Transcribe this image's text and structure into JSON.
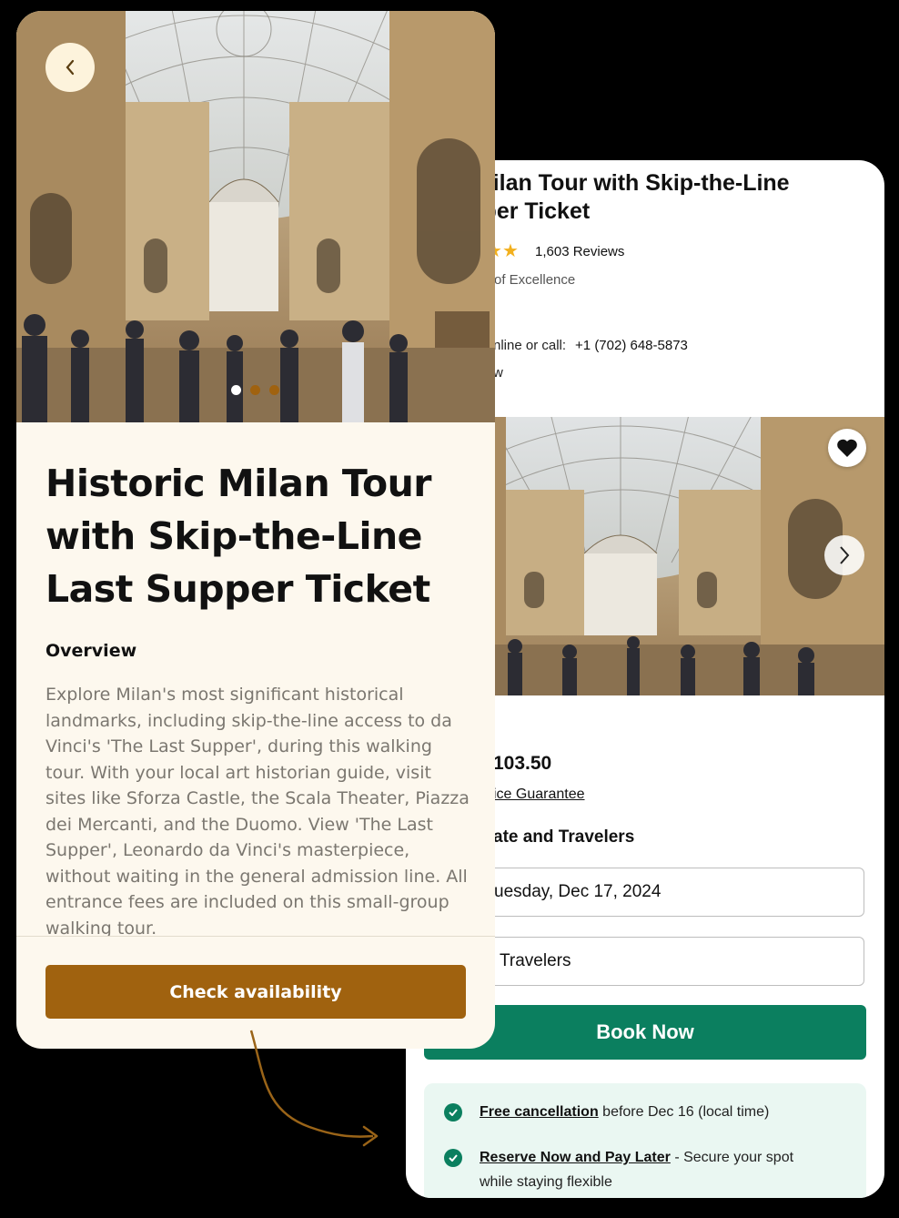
{
  "left": {
    "back_icon": "chevron-left-icon",
    "title": "Historic Milan Tour with Skip-the-Line Last Supper Ticket",
    "overview_heading": "Overview",
    "description": "Explore Milan's most significant historical landmarks, including skip-the-line access to da Vinci's 'The Last Supper', during this walking tour. With your local art historian guide, visit sites like Sforza Castle, the Scala Theater, Piazza dei Mercanti, and the Duomo. View 'The Last Supper', Leonardo da Vinci's masterpiece, without waiting in the general admission line. All entrance fees are included on this small-group walking tour.",
    "carousel_dots": 3,
    "carousel_active_index": 0,
    "check_button": "Check availability",
    "colors": {
      "background": "#fdf8ee",
      "accent": "#a0620f",
      "dot_active": "#ffffff",
      "dot_inactive": "#a0620f"
    }
  },
  "right": {
    "title": "c Milan Tour with Skip-the-Line\nupper Ticket",
    "reviews": "1,603 Reviews",
    "excellence": "of Excellence",
    "book_line": "nline or call:",
    "phone": "+1 (702) 648-5873",
    "view_fragment": "w",
    "heart_icon": "heart-icon",
    "next_icon": "chevron-right-icon",
    "price": "103.50",
    "guarantee": "ice Guarantee",
    "select_heading": "ate and Travelers",
    "date_value": "uesday, Dec 17, 2024",
    "travelers_value": "Travelers",
    "book_button": "Book Now",
    "perks": [
      {
        "link": "Free cancellation",
        "text": " before Dec 16 (local time)"
      },
      {
        "link": "Reserve Now and Pay Later",
        "text": " - Secure your spot while staying flexible"
      }
    ],
    "colors": {
      "accent": "#0b7f5f",
      "perks_bg": "#eaf7f2",
      "star": "#f2b01e"
    }
  },
  "arrow_icon": "curved-arrow-icon"
}
